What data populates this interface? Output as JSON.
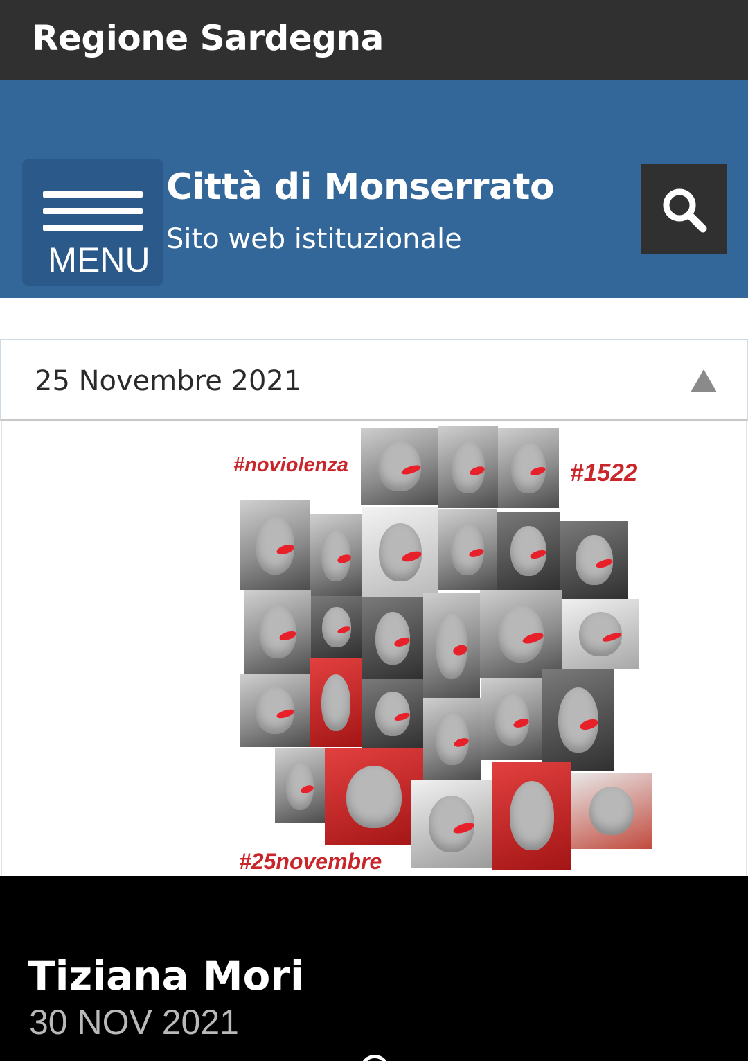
{
  "top_bar": {
    "region_label": "Regione Sardegna"
  },
  "header": {
    "menu_label": "MENU",
    "site_title": "Città di Monserrato",
    "site_subtitle": "Sito web istituzionale",
    "search_icon": "search-icon"
  },
  "accordion": {
    "title": "25 Novembre 2021",
    "expanded": true,
    "caret_icon": "caret-up-icon"
  },
  "collage": {
    "hashtags": [
      "#noviolenza",
      "#1522",
      "#25novembre"
    ],
    "accent_color": "#c9262b"
  },
  "news": {
    "author": "Tiziana Mori",
    "date": "30 NOV 2021"
  },
  "colors": {
    "top_bar": "#303030",
    "header": "#336699",
    "menu_button": "#2b5a8a",
    "search_button": "#303030",
    "footer": "#000000"
  }
}
